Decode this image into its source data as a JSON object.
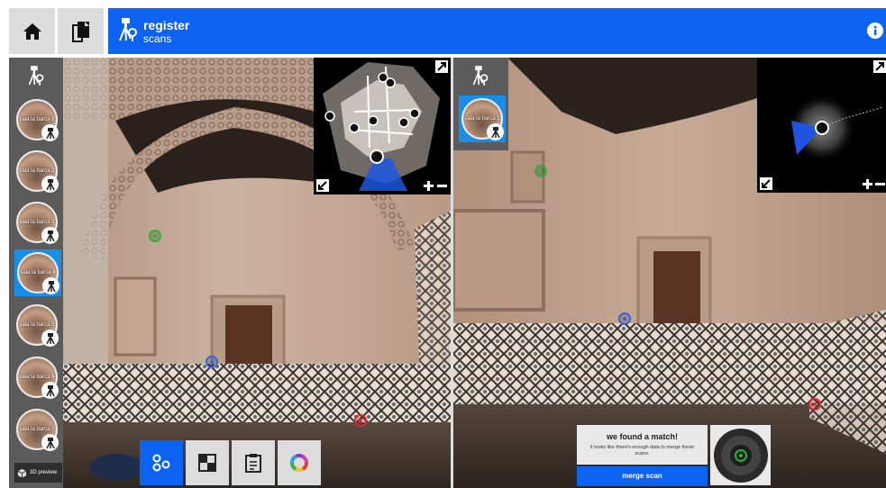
{
  "header": {
    "title": "register",
    "subtitle": "scans"
  },
  "left_scans": [
    {
      "label": "sala la barca 1"
    },
    {
      "label": "sala la barca 2"
    },
    {
      "label": "sala la barca 3"
    },
    {
      "label": "sala la barca 4"
    },
    {
      "label": "sala la barca 5"
    },
    {
      "label": "sala la barca 6"
    },
    {
      "label": "sala la barca 7"
    }
  ],
  "right_scans": [
    {
      "label": "sala la barca 1"
    }
  ],
  "preview_label": "3D preview",
  "match": {
    "title": "we found a match!",
    "message": "it looks like there's enough data to merge these scans.",
    "button_label": "merge scan"
  },
  "icons": [
    "home-icon",
    "copy-icon",
    "scanner-icon",
    "info-icon",
    "expand-icon",
    "collapse-icon",
    "zoom-in-icon",
    "zoom-out-icon",
    "points-icon",
    "checker-icon",
    "clipboard-icon",
    "color-wheel-icon",
    "cube-icon"
  ],
  "colors": {
    "accent": "#0d63f1",
    "selected": "#1a8ee6",
    "marker_green": "#28b43c",
    "marker_blue": "#3a5fe0",
    "marker_red": "#e02a2a"
  }
}
